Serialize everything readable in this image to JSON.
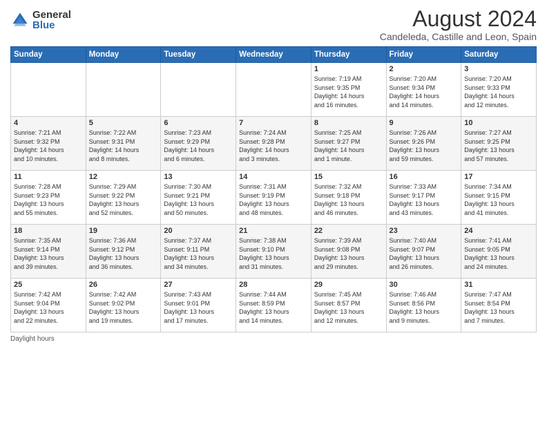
{
  "logo": {
    "general": "General",
    "blue": "Blue"
  },
  "title": "August 2024",
  "subtitle": "Candeleda, Castille and Leon, Spain",
  "days_of_week": [
    "Sunday",
    "Monday",
    "Tuesday",
    "Wednesday",
    "Thursday",
    "Friday",
    "Saturday"
  ],
  "footer": "Daylight hours",
  "weeks": [
    [
      {
        "day": "",
        "info": ""
      },
      {
        "day": "",
        "info": ""
      },
      {
        "day": "",
        "info": ""
      },
      {
        "day": "",
        "info": ""
      },
      {
        "day": "1",
        "info": "Sunrise: 7:19 AM\nSunset: 9:35 PM\nDaylight: 14 hours\nand 16 minutes."
      },
      {
        "day": "2",
        "info": "Sunrise: 7:20 AM\nSunset: 9:34 PM\nDaylight: 14 hours\nand 14 minutes."
      },
      {
        "day": "3",
        "info": "Sunrise: 7:20 AM\nSunset: 9:33 PM\nDaylight: 14 hours\nand 12 minutes."
      }
    ],
    [
      {
        "day": "4",
        "info": "Sunrise: 7:21 AM\nSunset: 9:32 PM\nDaylight: 14 hours\nand 10 minutes."
      },
      {
        "day": "5",
        "info": "Sunrise: 7:22 AM\nSunset: 9:31 PM\nDaylight: 14 hours\nand 8 minutes."
      },
      {
        "day": "6",
        "info": "Sunrise: 7:23 AM\nSunset: 9:29 PM\nDaylight: 14 hours\nand 6 minutes."
      },
      {
        "day": "7",
        "info": "Sunrise: 7:24 AM\nSunset: 9:28 PM\nDaylight: 14 hours\nand 3 minutes."
      },
      {
        "day": "8",
        "info": "Sunrise: 7:25 AM\nSunset: 9:27 PM\nDaylight: 14 hours\nand 1 minute."
      },
      {
        "day": "9",
        "info": "Sunrise: 7:26 AM\nSunset: 9:26 PM\nDaylight: 13 hours\nand 59 minutes."
      },
      {
        "day": "10",
        "info": "Sunrise: 7:27 AM\nSunset: 9:25 PM\nDaylight: 13 hours\nand 57 minutes."
      }
    ],
    [
      {
        "day": "11",
        "info": "Sunrise: 7:28 AM\nSunset: 9:23 PM\nDaylight: 13 hours\nand 55 minutes."
      },
      {
        "day": "12",
        "info": "Sunrise: 7:29 AM\nSunset: 9:22 PM\nDaylight: 13 hours\nand 52 minutes."
      },
      {
        "day": "13",
        "info": "Sunrise: 7:30 AM\nSunset: 9:21 PM\nDaylight: 13 hours\nand 50 minutes."
      },
      {
        "day": "14",
        "info": "Sunrise: 7:31 AM\nSunset: 9:19 PM\nDaylight: 13 hours\nand 48 minutes."
      },
      {
        "day": "15",
        "info": "Sunrise: 7:32 AM\nSunset: 9:18 PM\nDaylight: 13 hours\nand 46 minutes."
      },
      {
        "day": "16",
        "info": "Sunrise: 7:33 AM\nSunset: 9:17 PM\nDaylight: 13 hours\nand 43 minutes."
      },
      {
        "day": "17",
        "info": "Sunrise: 7:34 AM\nSunset: 9:15 PM\nDaylight: 13 hours\nand 41 minutes."
      }
    ],
    [
      {
        "day": "18",
        "info": "Sunrise: 7:35 AM\nSunset: 9:14 PM\nDaylight: 13 hours\nand 39 minutes."
      },
      {
        "day": "19",
        "info": "Sunrise: 7:36 AM\nSunset: 9:12 PM\nDaylight: 13 hours\nand 36 minutes."
      },
      {
        "day": "20",
        "info": "Sunrise: 7:37 AM\nSunset: 9:11 PM\nDaylight: 13 hours\nand 34 minutes."
      },
      {
        "day": "21",
        "info": "Sunrise: 7:38 AM\nSunset: 9:10 PM\nDaylight: 13 hours\nand 31 minutes."
      },
      {
        "day": "22",
        "info": "Sunrise: 7:39 AM\nSunset: 9:08 PM\nDaylight: 13 hours\nand 29 minutes."
      },
      {
        "day": "23",
        "info": "Sunrise: 7:40 AM\nSunset: 9:07 PM\nDaylight: 13 hours\nand 26 minutes."
      },
      {
        "day": "24",
        "info": "Sunrise: 7:41 AM\nSunset: 9:05 PM\nDaylight: 13 hours\nand 24 minutes."
      }
    ],
    [
      {
        "day": "25",
        "info": "Sunrise: 7:42 AM\nSunset: 9:04 PM\nDaylight: 13 hours\nand 22 minutes."
      },
      {
        "day": "26",
        "info": "Sunrise: 7:42 AM\nSunset: 9:02 PM\nDaylight: 13 hours\nand 19 minutes."
      },
      {
        "day": "27",
        "info": "Sunrise: 7:43 AM\nSunset: 9:01 PM\nDaylight: 13 hours\nand 17 minutes."
      },
      {
        "day": "28",
        "info": "Sunrise: 7:44 AM\nSunset: 8:59 PM\nDaylight: 13 hours\nand 14 minutes."
      },
      {
        "day": "29",
        "info": "Sunrise: 7:45 AM\nSunset: 8:57 PM\nDaylight: 13 hours\nand 12 minutes."
      },
      {
        "day": "30",
        "info": "Sunrise: 7:46 AM\nSunset: 8:56 PM\nDaylight: 13 hours\nand 9 minutes."
      },
      {
        "day": "31",
        "info": "Sunrise: 7:47 AM\nSunset: 8:54 PM\nDaylight: 13 hours\nand 7 minutes."
      }
    ]
  ]
}
